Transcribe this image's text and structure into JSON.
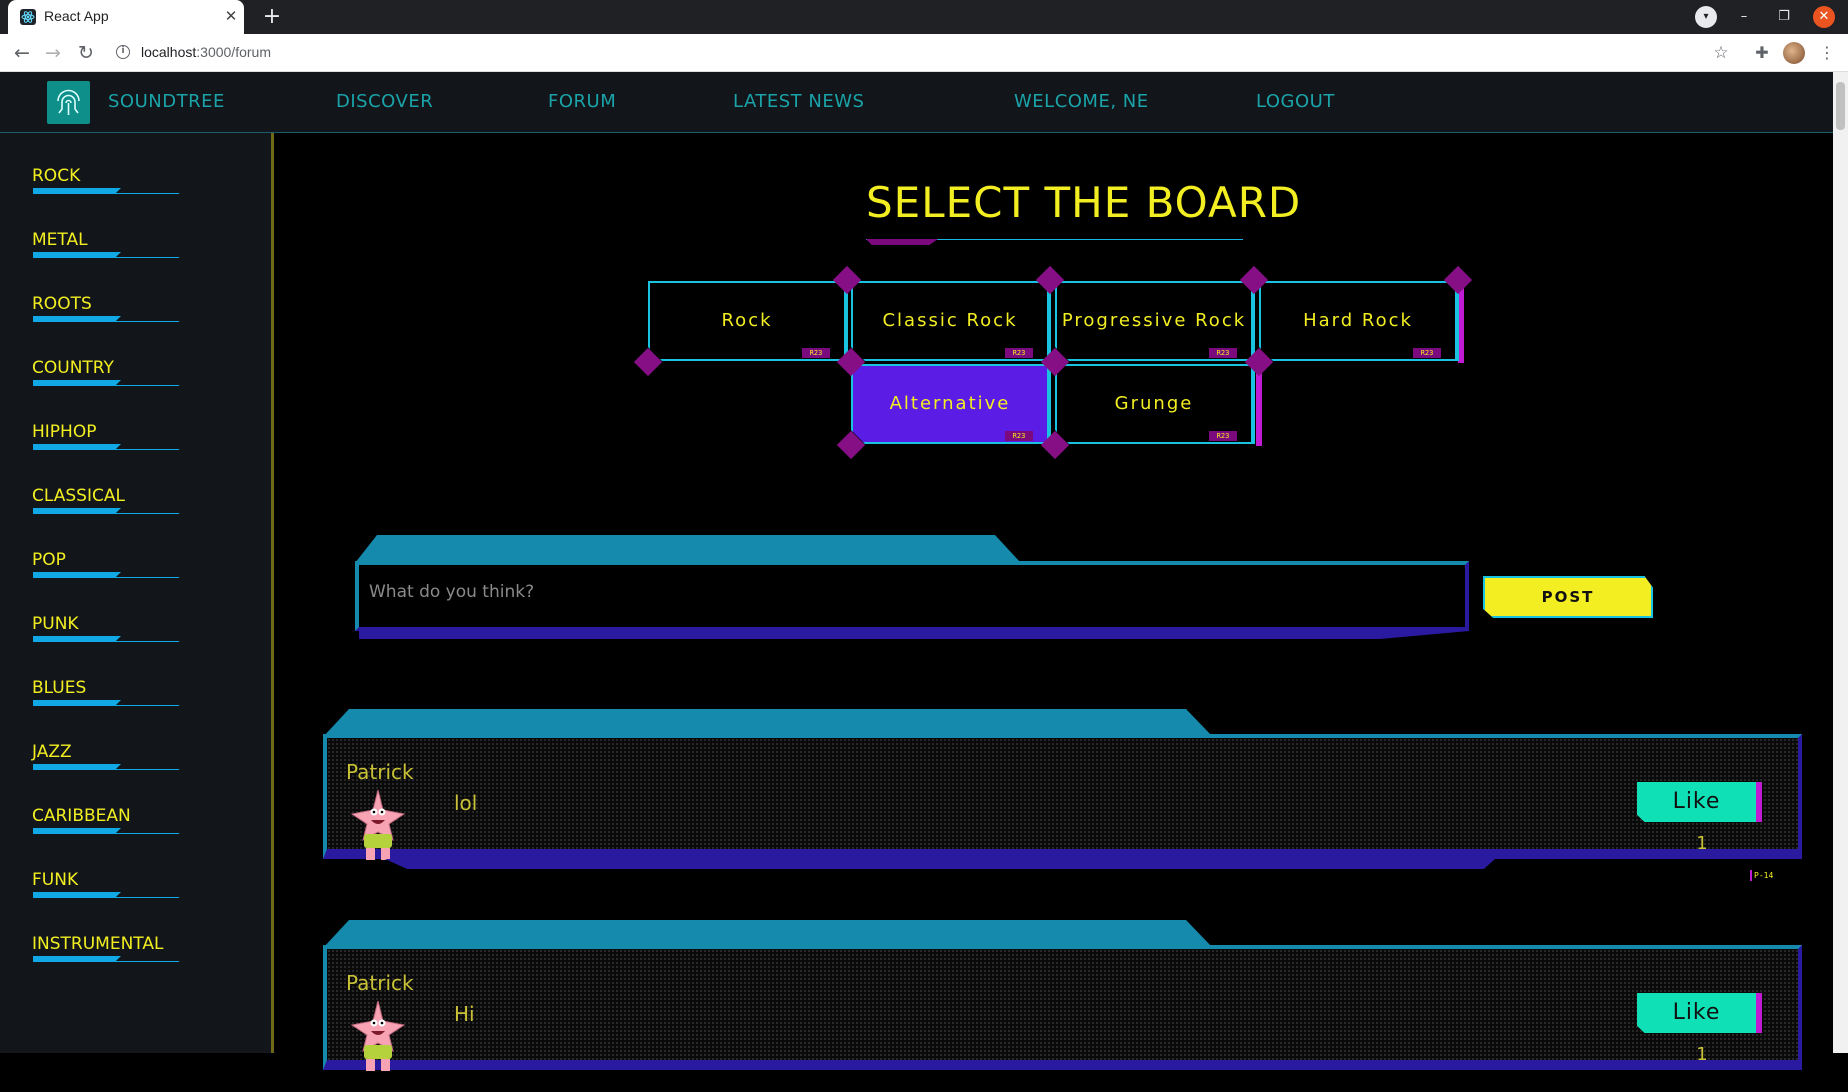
{
  "browser": {
    "tab_title": "React App",
    "url_host": "localhost",
    "url_rest": ":3000/forum",
    "new_tab": "+",
    "tab_close": "✕"
  },
  "header": {
    "brand": "SOUNDTREE",
    "links": [
      "DISCOVER",
      "FORUM",
      "LATEST NEWS",
      "WELCOME, NE",
      "LOGOUT"
    ]
  },
  "sidebar": {
    "genres": [
      "ROCK",
      "METAL",
      "ROOTS",
      "COUNTRY",
      "HIPHOP",
      "CLASSICAL",
      "POP",
      "PUNK",
      "BLUES",
      "JAZZ",
      "CARIBBEAN",
      "FUNK",
      "INSTRUMENTAL"
    ]
  },
  "main": {
    "title": "SELECT THE BOARD",
    "boards": [
      {
        "label": "Rock",
        "tag": "R23",
        "active": false
      },
      {
        "label": "Classic Rock",
        "tag": "R23",
        "active": false
      },
      {
        "label": "Progressive Rock",
        "tag": "R23",
        "active": false
      },
      {
        "label": "Hard Rock",
        "tag": "R23",
        "active": false
      },
      {
        "label": "Alternative",
        "tag": "R23",
        "active": true
      },
      {
        "label": "Grunge",
        "tag": "R23",
        "active": false
      }
    ],
    "post_placeholder": "What do you think?",
    "post_button": "POST",
    "posts": [
      {
        "author": "Patrick",
        "text": "lol",
        "like_label": "Like",
        "likes": "1",
        "tag": "P-14"
      },
      {
        "author": "Patrick",
        "text": "Hi",
        "like_label": "Like",
        "likes": "1"
      }
    ]
  },
  "colors": {
    "accent_yellow": "#f2ee22",
    "accent_cyan": "#19c2de",
    "accent_purple": "#870f86",
    "active_board": "#5b1de6",
    "like_green": "#0fe0b6"
  }
}
